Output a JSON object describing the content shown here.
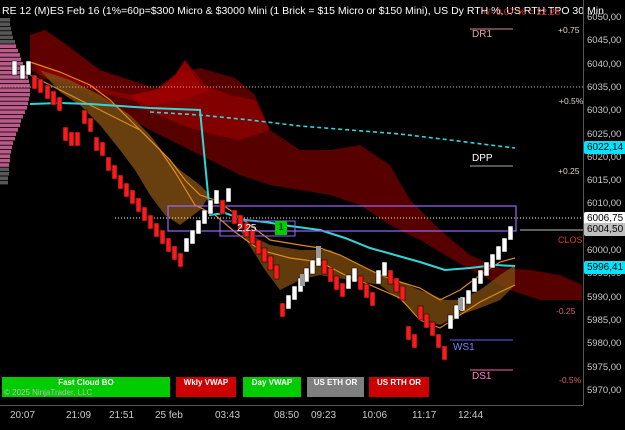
{
  "header": {
    "title": "RE 12 (M)ES Feb 16 (1%=60p=$300 Micro & $3000 Mini  (1 Brick = $15 Micro or $150 Mini), US Dy RTH %, US RTH TPO 30 Min",
    "change": "+/- 0.07 % = 22.25"
  },
  "price_axis": {
    "labels": [
      "6050,00",
      "6045,00",
      "6040,00",
      "6035,00",
      "6030,00",
      "6025,00",
      "6020,00",
      "6015,00",
      "6010,00",
      "6005,00",
      "6000,00",
      "5995,00",
      "5990,00",
      "5985,00",
      "5980,00",
      "5975,00",
      "5970,00"
    ],
    "tags": [
      {
        "label": "6022,14",
        "color": "#00e5ff"
      },
      {
        "label": "6006,75",
        "color": "#ffffff"
      },
      {
        "label": "6004,50",
        "color": "#bfbfbf"
      },
      {
        "label": "5996,41",
        "color": "#00e5ff"
      }
    ]
  },
  "time_axis": {
    "labels": [
      "20:07",
      "21:09",
      "21:51",
      "25 feb",
      "03:43",
      "08:50",
      "09:23",
      "10:06",
      "11:17",
      "12:44"
    ]
  },
  "levels": {
    "dr1": "DR1",
    "dpp": "DPP",
    "ws1": "WS1",
    "ds1": "DS1",
    "close": "CLOS"
  },
  "percent_labels": {
    "p075": "+0.75",
    "p05": "+0.5%",
    "p025": "+0.25",
    "m025": "-0.25",
    "m05": "-0.5%"
  },
  "overlay": {
    "box_value": "2,25",
    "box_count": "1"
  },
  "buttons": [
    {
      "label": "Fast Cloud BO",
      "color": "#00cc00",
      "text": "#ffffff"
    },
    {
      "label": "Wkly VWAP",
      "color": "#cc0000",
      "text": "#ffffff"
    },
    {
      "label": "Day VWAP",
      "color": "#00cc00",
      "text": "#ffffff"
    },
    {
      "label": "US ETH OR",
      "color": "#7f7f7f",
      "text": "#ffffff"
    },
    {
      "label": "US RTH OR",
      "color": "#cc0000",
      "text": "#ffffff"
    }
  ],
  "copyright": "© 2025 NinjaTrader, LLC",
  "colors": {
    "up_brick": "#ffffff",
    "down_brick": "#ff1a1a",
    "vwap": "#33d6d6",
    "cloud_orange": "#e08a1e",
    "cloud_red": "#8b0000"
  }
}
